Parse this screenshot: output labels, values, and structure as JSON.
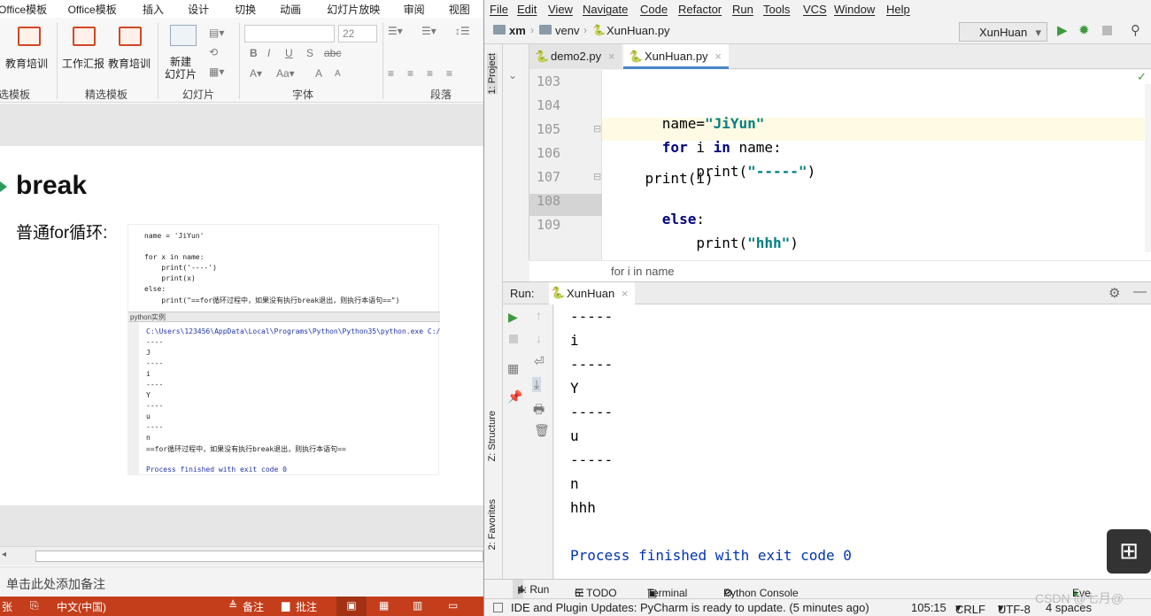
{
  "ppt": {
    "tabs": [
      "Office模板",
      "Office模板",
      "插入",
      "设计",
      "切换",
      "动画",
      "幻灯片放映",
      "审阅",
      "视图"
    ],
    "ribbon": {
      "btn_edu1": "教育培训",
      "btn_work": "工作汇报",
      "btn_edu2": "教育培训",
      "btn_new_slide_1": "新建",
      "btn_new_slide_2": "幻灯片",
      "group_template": "选模板",
      "group_selected": "精选模板",
      "group_slide": "幻灯片",
      "group_font": "字体",
      "group_para": "段落",
      "font_size": "22"
    },
    "slide": {
      "title": "break",
      "subtitle": "普通for循环:",
      "code_lines": [
        "name = 'JiYun'",
        "for x in name:",
        "    print('----')",
        "    print(x)",
        "else:",
        "    print(\"==for循环过程中，如果没有执行break退出，则执行本语句==\")"
      ],
      "output_bar": "python实例",
      "output_lines": [
        "C:\\Users\\123456\\AppData\\Local\\Programs\\Python\\Python35\\python.exe C:/",
        "----",
        "J",
        "----",
        "i",
        "----",
        "Y",
        "----",
        "u",
        "----",
        "n",
        "==for循环过程中，如果没有执行break退出，则执行本语句==",
        "",
        "Process finished with exit code 0"
      ]
    },
    "notes_placeholder": "单击此处添加备注",
    "status": {
      "slide": "张",
      "lang": "中文(中国)",
      "notes": "备注",
      "comments": "批注"
    }
  },
  "pycharm": {
    "menu": [
      "File",
      "Edit",
      "View",
      "Navigate",
      "Code",
      "Refactor",
      "Run",
      "Tools",
      "VCS",
      "Window",
      "Help"
    ],
    "breadcrumb": [
      "xm",
      "venv",
      "XunHuan.py"
    ],
    "run_config": "XunHuan",
    "tabs": [
      "demo2.py",
      "XunHuan.py"
    ],
    "line_numbers": [
      "103",
      "104",
      "105",
      "106",
      "107",
      "108",
      "109"
    ],
    "code": {
      "l104_a": "name=",
      "l104_b": "\"JiYun\"",
      "l105_kw1": "for",
      "l105_mid": " i ",
      "l105_kw2": "in",
      "l105_end": " name:",
      "l106_a": "    print(",
      "l106_b": "\"-----\"",
      "l106_c": ")",
      "l107": "    print(i)",
      "l108_kw": "else",
      "l108_end": ":",
      "l109_a": "    print(",
      "l109_b": "\"hhh\"",
      "l109_c": ")"
    },
    "code_breadcrumb": "for i in name",
    "run_label": "Run:",
    "run_tab": "XunHuan",
    "console_lines": [
      "-----",
      "i",
      "-----",
      "Y",
      "-----",
      "u",
      "-----",
      "n",
      "hhh"
    ],
    "console_exit": "Process finished with exit code 0",
    "side_tabs": {
      "project": "1: Project",
      "structure": "Z: Structure",
      "favorites": "2: Favorites"
    },
    "bottom_tabs": [
      "4: Run",
      "6: TODO",
      "Terminal",
      "Python Console",
      "Eve"
    ],
    "status": {
      "message": "IDE and Plugin Updates: PyCharm is ready to update. (5 minutes ago)",
      "position": "105:15",
      "line_sep": "CRLF",
      "encoding": "UTF-8",
      "indent": "4 spaces"
    },
    "watermark": "CSDN @七月@",
    "colors": {
      "keyword": "#000080",
      "string": "#008080",
      "ppt_status": "#c43e1c",
      "console_exit": "#0033b3"
    }
  }
}
